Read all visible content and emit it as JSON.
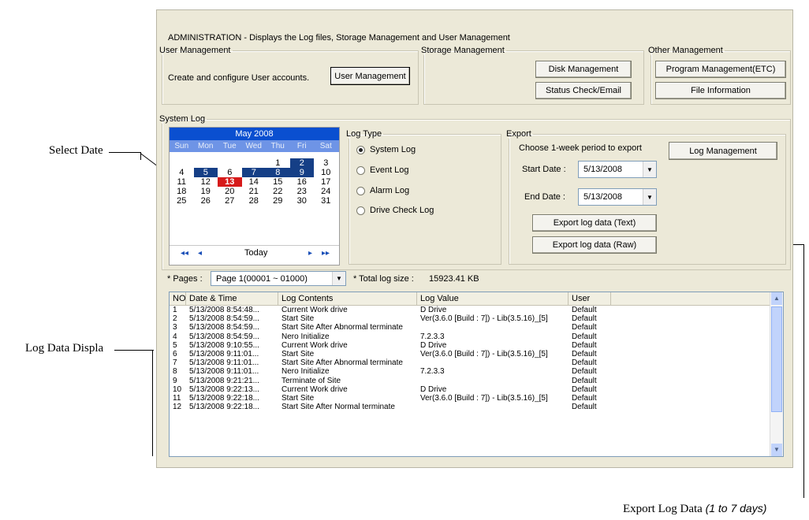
{
  "header": {
    "title": "ADMINISTRATION - Displays the Log files,  Storage Management and User Management"
  },
  "user_mgmt": {
    "legend": "User Management",
    "description": "Create and configure User accounts.",
    "button": "User Management"
  },
  "storage_mgmt": {
    "legend": "Storage Management",
    "disk_button": "Disk Management",
    "status_button": "Status Check/Email"
  },
  "other_mgmt": {
    "legend": "Other Management",
    "program_button": "Program Management(ETC)",
    "file_button": "File Information"
  },
  "system_log": {
    "legend": "System Log",
    "calendar": {
      "month": "May 2008",
      "weekdays": [
        "Sun",
        "Mon",
        "Tue",
        "Wed",
        "Thu",
        "Fri",
        "Sat"
      ],
      "weeks": [
        [
          "",
          "",
          "",
          "",
          "1",
          "2",
          "3"
        ],
        [
          "4",
          "5",
          "6",
          "7",
          "8",
          "9",
          "10"
        ],
        [
          "11",
          "12",
          "13",
          "14",
          "15",
          "16",
          "17"
        ],
        [
          "18",
          "19",
          "20",
          "21",
          "22",
          "23",
          "24"
        ],
        [
          "25",
          "26",
          "27",
          "28",
          "29",
          "30",
          "31"
        ]
      ],
      "selected_days": [
        "2",
        "5",
        "7",
        "8",
        "9"
      ],
      "today_day": "13",
      "today_label": "Today"
    },
    "log_type": {
      "legend": "Log Type",
      "options": [
        "System Log",
        "Event Log",
        "Alarm Log",
        "Drive Check Log"
      ],
      "selected": "System Log"
    },
    "export": {
      "legend": "Export",
      "instruction": "Choose 1-week period to export",
      "start_label": "Start Date :",
      "start_value": "5/13/2008",
      "end_label": "End Date :",
      "end_value": "5/13/2008",
      "export_text_button": "Export log data (Text)",
      "export_raw_button": "Export log data (Raw)",
      "log_mgmt_button": "Log Management"
    }
  },
  "pages": {
    "label": "* Pages :",
    "selected": "Page 1(00001 ~ 01000)",
    "total_label": "* Total log size :",
    "total_value": "15923.41 KB"
  },
  "table": {
    "columns": [
      "NO",
      "Date & Time",
      "Log Contents",
      "Log Value",
      "User",
      ""
    ],
    "rows": [
      [
        "1",
        "5/13/2008 8:54:48...",
        "Current Work drive",
        "D Drive",
        "Default"
      ],
      [
        "2",
        "5/13/2008 8:54:59...",
        "Start Site",
        "Ver(3.6.0 [Build : 7]) - Lib(3.5.16)_[5]",
        "Default"
      ],
      [
        "3",
        "5/13/2008 8:54:59...",
        "Start Site After Abnormal terminate",
        "",
        "Default"
      ],
      [
        "4",
        "5/13/2008 8:54:59...",
        "Nero Initialize",
        "7.2.3.3",
        "Default"
      ],
      [
        "5",
        "5/13/2008 9:10:55...",
        "Current Work drive",
        "D Drive",
        "Default"
      ],
      [
        "6",
        "5/13/2008 9:11:01...",
        "Start Site",
        "Ver(3.6.0 [Build : 7]) - Lib(3.5.16)_[5]",
        "Default"
      ],
      [
        "7",
        "5/13/2008 9:11:01...",
        "Start Site After Abnormal terminate",
        "",
        "Default"
      ],
      [
        "8",
        "5/13/2008 9:11:01...",
        "Nero Initialize",
        "7.2.3.3",
        "Default"
      ],
      [
        "9",
        "5/13/2008 9:21:21...",
        "Terminate of Site",
        "",
        "Default"
      ],
      [
        "10",
        "5/13/2008 9:22:13...",
        "Current Work drive",
        "D Drive",
        "Default"
      ],
      [
        "11",
        "5/13/2008 9:22:18...",
        "Start Site",
        "Ver(3.6.0 [Build : 7]) - Lib(3.5.16)_[5]",
        "Default"
      ],
      [
        "12",
        "5/13/2008 9:22:18...",
        "Start Site After Normal terminate",
        "",
        "Default"
      ]
    ]
  },
  "annotations": {
    "select_date": "Select Date",
    "log_data_display": "Log Data Displa",
    "export_log_data": "Export Log Data ",
    "export_log_data_range": "(1 to 7 days)"
  },
  "colors": {
    "panel": "#ece9d8",
    "calendar_header": "#0a4fd0",
    "calendar_dow": "#6e94e6",
    "selected_day": "#153f86",
    "today": "#d61a1a"
  }
}
